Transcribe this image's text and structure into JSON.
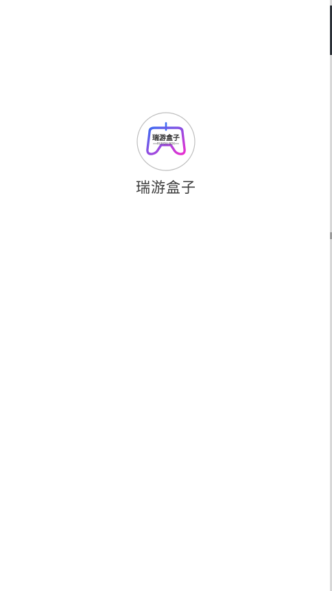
{
  "splash": {
    "app_name": "瑞游盒子",
    "logo": {
      "icon": "gamepad-logo-icon",
      "text_cn": "瑞游盒子",
      "text_en": "RUIYOU BOX",
      "gradient_start": "#3b6cf2",
      "gradient_end": "#ea2fd0",
      "ring_color": "#bdbdbd"
    }
  }
}
